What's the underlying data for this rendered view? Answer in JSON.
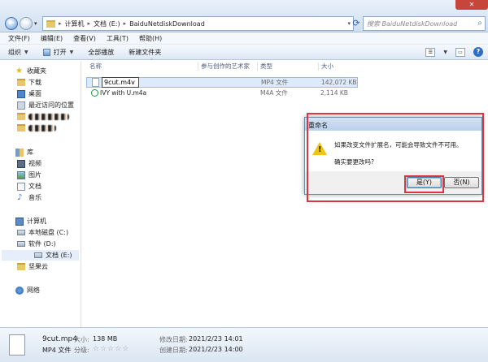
{
  "addressbar": {
    "back": "←",
    "forward": "→",
    "path_root_sep": "▸",
    "crumbs": [
      "计算机",
      "文档 (E:)",
      "BaiduNetdiskDownload"
    ],
    "search_placeholder": "搜索 BaiduNetdiskDownload"
  },
  "menu": [
    "文件(F)",
    "编辑(E)",
    "查看(V)",
    "工具(T)",
    "帮助(H)"
  ],
  "toolbar": {
    "organize": "组织",
    "open": "打开",
    "play_all": "全部播放",
    "new_folder": "新建文件夹"
  },
  "nav": {
    "favorites": "收藏夹",
    "downloads": "下载",
    "desktop": "桌面",
    "recent": "最近访问的位置",
    "library": "库",
    "videos": "视频",
    "pictures": "图片",
    "documents": "文档",
    "music": "音乐",
    "computer": "计算机",
    "drive_c": "本地磁盘 (C:)",
    "drive_d": "软件 (D:)",
    "drive_e": "文档 (E:)",
    "cloud": "坚果云",
    "network": "网络"
  },
  "columns": {
    "name": "名称",
    "artist": "参与创作的艺术家",
    "type": "类型",
    "size": "大小"
  },
  "files": [
    {
      "name": "9cut.m4v",
      "type": "MP4 文件",
      "size": "142,072 KB"
    },
    {
      "name": "IVY with U.m4a",
      "type": "M4A 文件",
      "size": "2,114 KB"
    }
  ],
  "dialog": {
    "title": "重命名",
    "message": "如果改变文件扩展名，可能会导致文件不可用。",
    "question": "确实要更改吗?",
    "yes": "是(Y)",
    "no": "否(N)"
  },
  "details": {
    "filename": "9cut.mp4",
    "filetype": "MP4 文件",
    "size_label": "大小:",
    "size_value": "138 MB",
    "rating_label": "分级:",
    "rating_stars": "☆☆☆☆☆",
    "modified_label": "修改日期:",
    "modified_value": "2021/2/23 14:01",
    "created_label": "创建日期:",
    "created_value": "2021/2/23 14:00"
  }
}
